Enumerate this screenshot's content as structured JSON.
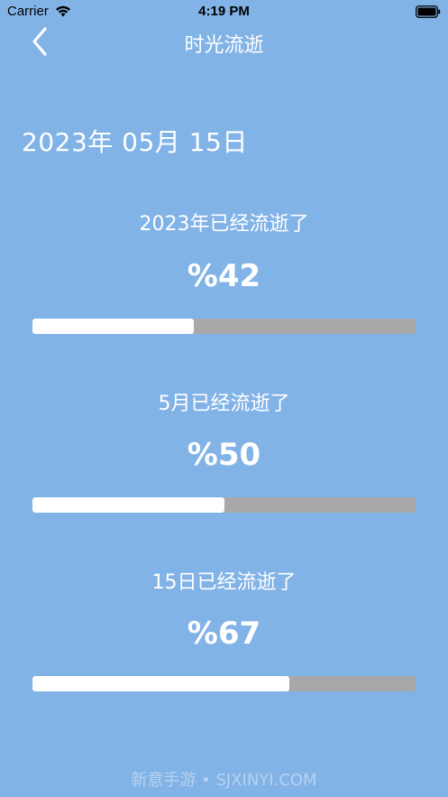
{
  "status_bar": {
    "carrier": "Carrier",
    "time": "4:19 PM"
  },
  "nav": {
    "title": "时光流逝",
    "back_icon": "chevron-left-icon"
  },
  "date": "2023年 05月 15日",
  "progress_sections": [
    {
      "label": "2023年已经流逝了",
      "percent_text": "%42",
      "progress": 0.42
    },
    {
      "label": "5月已经流逝了",
      "percent_text": "%50",
      "progress": 0.5
    },
    {
      "label": "15日已经流逝了",
      "percent_text": "%67",
      "progress": 0.67
    }
  ],
  "watermark": "新意手游 • SJXINYI.COM",
  "colors": {
    "background": "#82b3e7",
    "track": "#a8a8a8",
    "fill": "#ffffff"
  }
}
